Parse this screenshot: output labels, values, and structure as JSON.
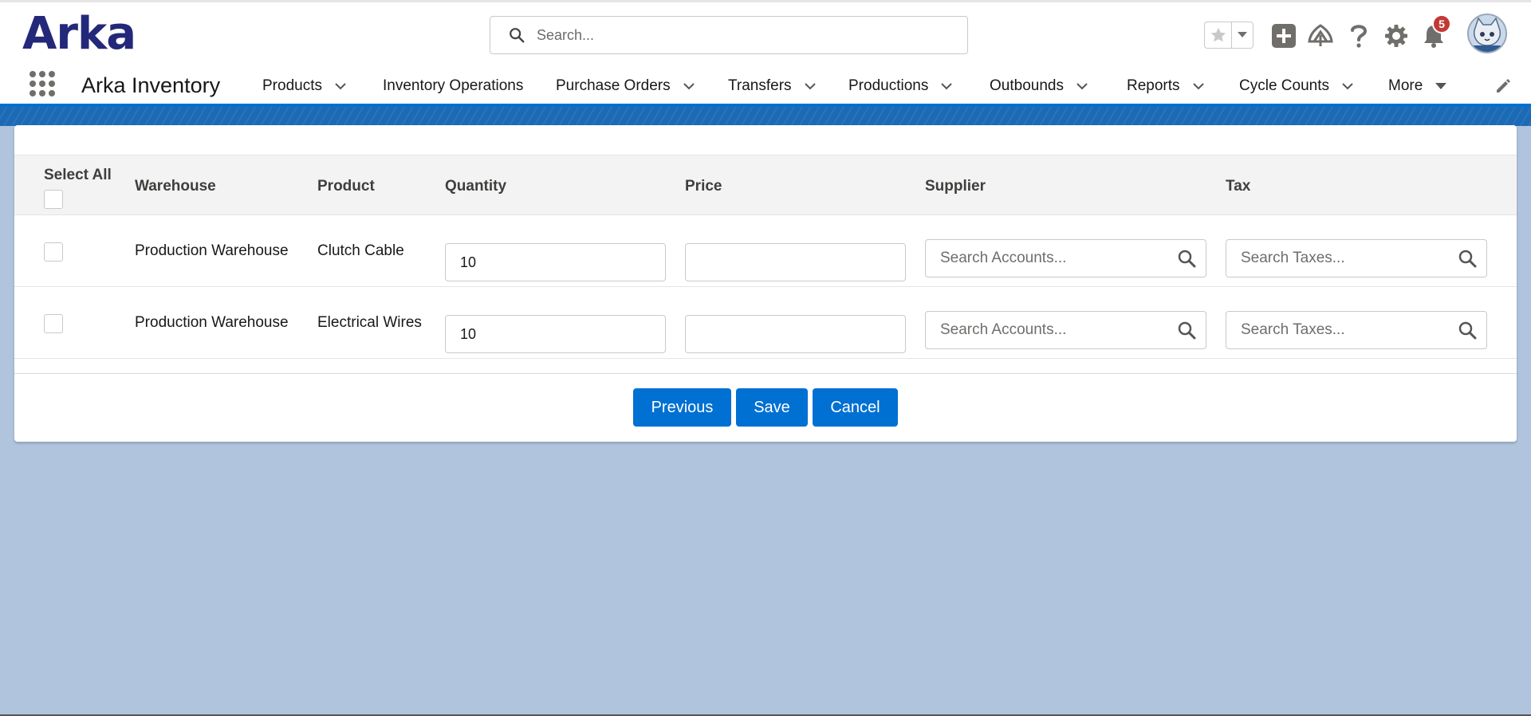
{
  "header": {
    "logo": "Arka",
    "search": {
      "placeholder": "Search...",
      "value": ""
    },
    "notifications_count": "5",
    "icons": [
      "favorites-star-icon",
      "chevron-down-icon",
      "add-icon",
      "trailhead-icon",
      "help-icon",
      "settings-icon",
      "bell-icon",
      "avatar"
    ]
  },
  "nav": {
    "app_name": "Arka Inventory",
    "items": [
      {
        "label": "Products",
        "has_menu": true
      },
      {
        "label": "Inventory Operations",
        "has_menu": false
      },
      {
        "label": "Purchase Orders",
        "has_menu": true
      },
      {
        "label": "Transfers",
        "has_menu": true
      },
      {
        "label": "Productions",
        "has_menu": true
      },
      {
        "label": "Outbounds",
        "has_menu": true
      },
      {
        "label": "Reports",
        "has_menu": true
      },
      {
        "label": "Cycle Counts",
        "has_menu": true
      },
      {
        "label": "More",
        "has_menu": true
      }
    ]
  },
  "table": {
    "columns": {
      "select_all": "Select All",
      "warehouse": "Warehouse",
      "product": "Product",
      "quantity": "Quantity",
      "price": "Price",
      "supplier": "Supplier",
      "tax": "Tax"
    },
    "rows": [
      {
        "warehouse": "Production Warehouse",
        "product": "Clutch Cable",
        "quantity": "10",
        "price": "",
        "supplier_placeholder": "Search Accounts...",
        "tax_placeholder": "Search Taxes..."
      },
      {
        "warehouse": "Production Warehouse",
        "product": "Electrical Wires",
        "quantity": "10",
        "price": "",
        "supplier_placeholder": "Search Accounts...",
        "tax_placeholder": "Search Taxes..."
      }
    ]
  },
  "actions": {
    "previous": "Previous",
    "save": "Save",
    "cancel": "Cancel"
  },
  "colors": {
    "brand_blue": "#0070d2",
    "logo_navy": "#24287a",
    "page_background": "#b0c4de",
    "badge_red": "#c23934"
  }
}
